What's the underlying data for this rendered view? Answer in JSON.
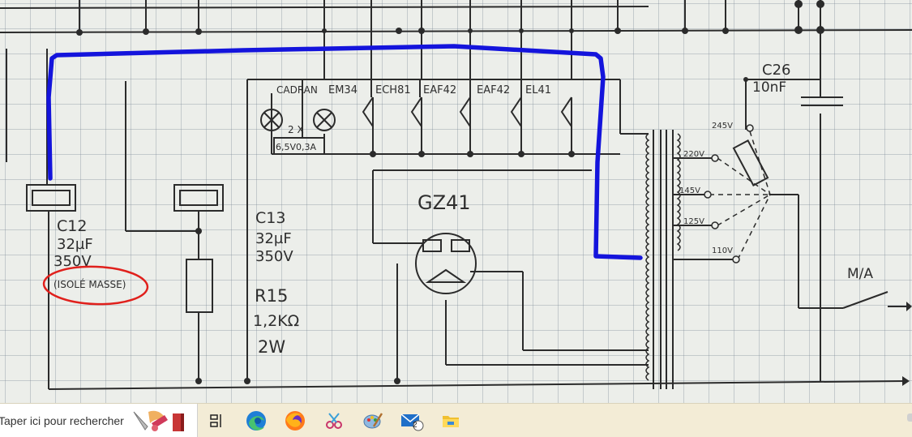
{
  "schematic": {
    "tube_labels": [
      "CADRAN",
      "EM34",
      "ECH81",
      "EAF42",
      "EAF42",
      "EL41"
    ],
    "lamp_note_1": "2 X",
    "lamp_note_2": "6,5V0,3A",
    "rectifier_label": "GZ41",
    "c12": {
      "name": "C12",
      "value": "32µF",
      "voltage": "350V",
      "note": "(ISOLÉ MASSE)"
    },
    "c13": {
      "name": "C13",
      "value": "32µF",
      "voltage": "350V"
    },
    "r15": {
      "name": "R15",
      "value": "1,2KΩ",
      "power": "2W"
    },
    "c26": {
      "name": "C26",
      "value": "10nF"
    },
    "taps": [
      "245V",
      "220V",
      "145V",
      "125V",
      "110V"
    ],
    "switch_label": "M/A",
    "colors": {
      "highlight_wire": "#1414dc",
      "annotation_circle": "#e0201c",
      "ink": "#2e2e2e"
    }
  },
  "taskbar": {
    "search_placeholder": "Taper ici pour rechercher",
    "mail_badge": "2",
    "apps": [
      "task-view-icon",
      "edge-icon",
      "firefox-icon",
      "snip-icon",
      "paint-icon",
      "mail-icon",
      "file-explorer-icon"
    ]
  }
}
